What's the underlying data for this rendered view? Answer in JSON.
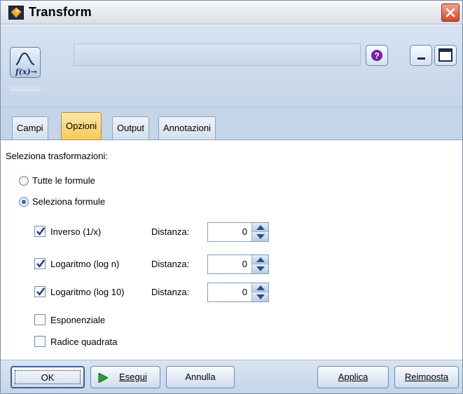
{
  "window": {
    "title": "Transform",
    "icon": "diamond-node-icon"
  },
  "header": {
    "node_icon": "fx-transform-icon",
    "help_icon": "help-icon",
    "minimize_icon": "minimize-icon",
    "maximize_icon": "maximize-icon"
  },
  "tabs": [
    {
      "label": "Campi",
      "active": false
    },
    {
      "label": "Opzioni",
      "active": true
    },
    {
      "label": "Output",
      "active": false
    },
    {
      "label": "Annotazioni",
      "active": false
    }
  ],
  "options": {
    "section_label": "Seleziona trasformazioni:",
    "radio_all": {
      "label": "Tutte le formule",
      "selected": false
    },
    "radio_select": {
      "label": "Seleziona formule",
      "selected": true
    },
    "formulas": [
      {
        "label": "Inverso (1/x)",
        "checked": true,
        "offset_label": "Distanza:",
        "offset_value": "0"
      },
      {
        "label": "Logaritmo (log n)",
        "checked": true,
        "offset_label": "Distanza:",
        "offset_value": "0"
      },
      {
        "label": "Logaritmo (log 10)",
        "checked": true,
        "offset_label": "Distanza:",
        "offset_value": "0"
      },
      {
        "label": "Esponenziale",
        "checked": false
      },
      {
        "label": "Radice quadrata",
        "checked": false
      }
    ]
  },
  "footer": {
    "ok_label": "OK",
    "run_label": "Esegui",
    "cancel_label": "Annulla",
    "apply_label": "Applica",
    "reset_label": "Reimposta"
  },
  "colors": {
    "active_tab": "#f8c95a",
    "header_bg": "#c5d5e8",
    "run_icon": "#2f9a3a",
    "close_button": "#d3472b"
  }
}
